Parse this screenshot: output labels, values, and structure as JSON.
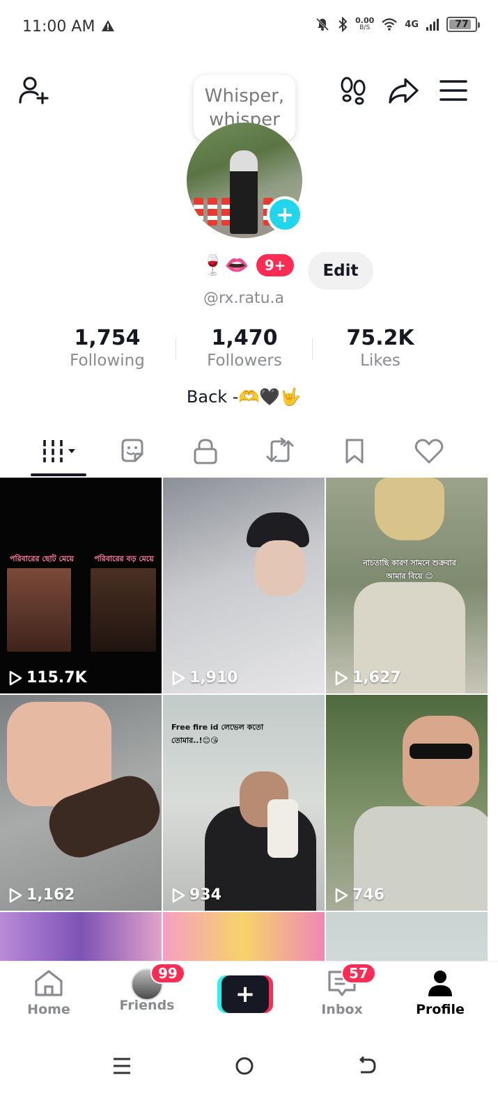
{
  "status_bar": {
    "time": "11:00 AM",
    "net_speed_value": "0.00",
    "net_speed_unit": "B/S",
    "network_type": "4G",
    "battery_level": "77"
  },
  "header": {
    "tooltip_text": "Whisper, whisper"
  },
  "profile": {
    "name_emojis": "🍷👄",
    "notification_badge": "9+",
    "edit_label": "Edit",
    "username": "@rx.ratu.a",
    "bio": "Back  -🫶🖤🤟"
  },
  "stats": [
    {
      "value": "1,754",
      "label": "Following"
    },
    {
      "value": "1,470",
      "label": "Followers"
    },
    {
      "value": "75.2K",
      "label": "Likes"
    }
  ],
  "videos": [
    {
      "views": "115.7K"
    },
    {
      "views": "1,910"
    },
    {
      "views": "1,627"
    },
    {
      "views": "1,162"
    },
    {
      "views": "934",
      "caption": "Free fire id লেভেল কতো তোমার..!😊😘"
    },
    {
      "views": "746"
    }
  ],
  "video_captions": {
    "video1_left": "পরিবারের ছোট মেয়ে",
    "video1_right": "পরিবারের বড় মেয়ে",
    "video3": "নাচতাছি কারণ সামনে শুক্রবার আমার বিয়ে 😊"
  },
  "bottom_nav": {
    "home": "Home",
    "friends": "Friends",
    "friends_badge": "99",
    "inbox": "Inbox",
    "inbox_badge": "57",
    "profile": "Profile"
  }
}
